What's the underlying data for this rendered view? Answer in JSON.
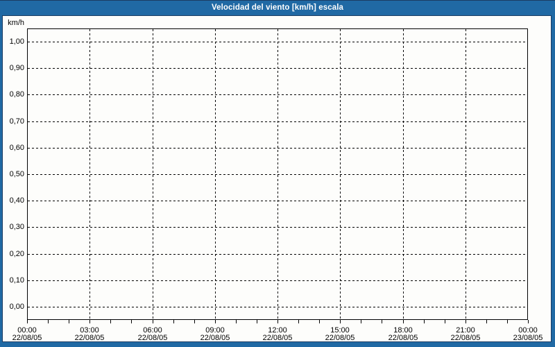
{
  "window": {
    "title": "Velocidad del viento [km/h] escala",
    "colors": {
      "frame_blue": "#2069A4",
      "frame_dark_line": "#1B3C62",
      "content_background": "#FDFDFB",
      "grid_and_text": "#000000",
      "title_text": "#FFFFFF"
    }
  },
  "chart_data": {
    "type": "line",
    "title": "Velocidad del viento [km/h] escala",
    "ylabel": "km/h",
    "xlabel": "",
    "ylim": [
      0.0,
      1.0
    ],
    "y_tick_step": 0.1,
    "y_tick_labels": [
      "1,00",
      "0,90",
      "0,80",
      "0,70",
      "0,60",
      "0,50",
      "0,40",
      "0,30",
      "0,20",
      "0,10",
      "0,00"
    ],
    "x_range_hours": 24,
    "major_tick_interval_hours": 3,
    "minor_tick_interval_hours": 1,
    "x_ticks": [
      {
        "time": "00:00",
        "date": "22/08/05"
      },
      {
        "time": "03:00",
        "date": "22/08/05"
      },
      {
        "time": "06:00",
        "date": "22/08/05"
      },
      {
        "time": "09:00",
        "date": "22/08/05"
      },
      {
        "time": "12:00",
        "date": "22/08/05"
      },
      {
        "time": "15:00",
        "date": "22/08/05"
      },
      {
        "time": "18:00",
        "date": "22/08/05"
      },
      {
        "time": "21:00",
        "date": "22/08/05"
      },
      {
        "time": "00:00",
        "date": "23/08/05"
      }
    ],
    "grid": true,
    "grid_style": "dashed",
    "legend": null,
    "series": []
  }
}
